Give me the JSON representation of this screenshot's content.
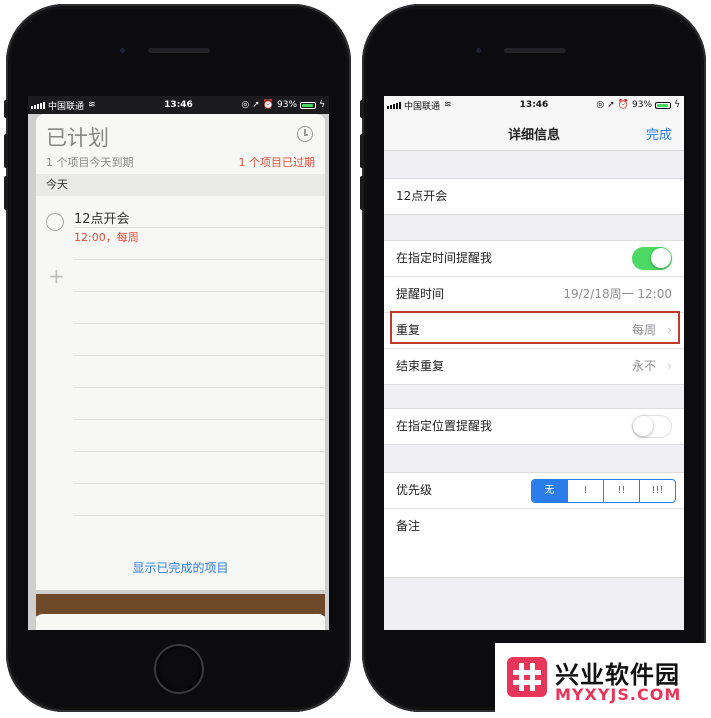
{
  "status": {
    "carrier": "中国联通",
    "time": "13:46",
    "battery": "93%",
    "battery_level": 0.93
  },
  "left": {
    "list_title": "已计划",
    "due_count": "1 个项目今天到期",
    "overdue": "1 个项目已过期",
    "section": "今天",
    "item_title": "12点开会",
    "item_detail": "12:00，每周",
    "plus": "+",
    "show_completed": "显示已完成的项目"
  },
  "right": {
    "nav_title": "详细信息",
    "done": "完成",
    "reminder_title": "12点开会",
    "remind_on_day": "在指定时间提醒我",
    "remind_on_day_on": true,
    "alarm_label": "提醒时间",
    "alarm_value": "19/2/18周一 12:00",
    "repeat_label": "重复",
    "repeat_value": "每周",
    "end_repeat_label": "结束重复",
    "end_repeat_value": "永不",
    "remind_at_location": "在指定位置提醒我",
    "remind_at_location_on": false,
    "priority_label": "优先级",
    "priority_options": [
      "无",
      "!",
      "!!",
      "!!!"
    ],
    "priority_selected": 0,
    "notes_label": "备注",
    "chevron": "›"
  },
  "watermark": {
    "name": "兴业软件园",
    "url": "MYXYJS.COM"
  },
  "colors": {
    "accent_blue": "#2b7de9",
    "alert_red": "#e74c3c",
    "toggle_green": "#4cd964",
    "highlight_red": "#c0392b",
    "brand_pink": "#e8365a"
  }
}
